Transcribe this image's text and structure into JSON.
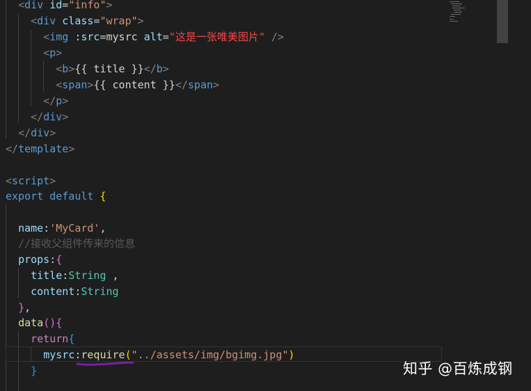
{
  "code": {
    "div_tag": "div",
    "img_tag": "img",
    "p_tag": "p",
    "b_tag": "b",
    "span_tag": "span",
    "template_tag": "template",
    "script_tag": "script",
    "id_attr": "id",
    "id_value": "\"info\"",
    "class_attr": "class",
    "class_value": "\"wrap\"",
    "src_attr": ":src",
    "src_value": "mysrc",
    "alt_attr": "alt",
    "alt_value": "\"这是一张唯美图片\"",
    "title_binding": "{{ title }}",
    "content_binding": "{{ content }}",
    "export_kw": "export",
    "default_kw": "default",
    "name_key": "name",
    "name_value": "'MyCard'",
    "comment": "//接收父组件传来的信息",
    "props_key": "props",
    "title_key": "title",
    "content_key": "content",
    "type_string": "String",
    "data_func": "data",
    "return_kw": "return",
    "mysrc_key": "mysrc",
    "require_func": "require",
    "require_arg": "\"../assets/img/bgimg.jpg\""
  },
  "watermark": {
    "text": "知乎 @百炼成钢"
  },
  "colors": {
    "background": "#1e1e1e",
    "tag": "#569cd6",
    "attribute": "#9cdcfe",
    "string": "#ce9178",
    "keyword_control": "#c586c0",
    "type": "#4ec9b0",
    "function": "#dcdcaa",
    "comment": "#6a9955",
    "squiggle": "#7b1fa2"
  }
}
